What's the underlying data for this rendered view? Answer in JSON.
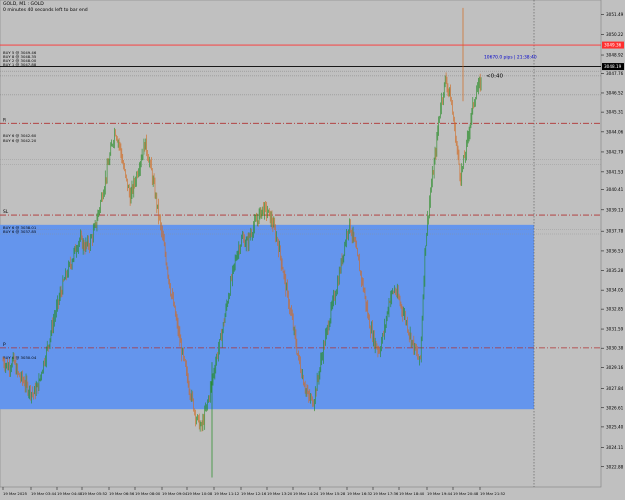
{
  "window": {
    "title": "GOLD, M1 : GOLD",
    "timer": "0 minutes 40 seconds left to bar end"
  },
  "colors": {
    "background": "#c0c0c0",
    "zone": "#6495ed",
    "bull": "#228b22",
    "bear": "#d2691e",
    "level_line": "#b03030",
    "price_line_red": "#ff3030",
    "price_line_black": "#000000",
    "label_blue": "#0000cc"
  },
  "chart_data": {
    "type": "candlestick",
    "symbol": "GOLD",
    "timeframe": "M1",
    "ylim": [
      3021.6,
      3052.4
    ],
    "y_ticks": [
      "3051.49",
      "3050.22",
      "3048.92",
      "3047.76",
      "3046.52",
      "3045.31",
      "3044.06",
      "3042.79",
      "3041.53",
      "3040.41",
      "3039.13",
      "3037.78",
      "3036.53",
      "3035.28",
      "3034.05",
      "3032.85",
      "3031.59",
      "3030.38",
      "3029.16",
      "3027.84",
      "3026.61",
      "3025.40",
      "3024.11",
      "3022.88"
    ],
    "x_ticks": [
      "19 Mar 2025",
      "19 Mar 03:44",
      "19 Mar 04:48",
      "19 Mar 05:52",
      "19 Mar 06:56",
      "19 Mar 08:00",
      "19 Mar 09:04",
      "19 Mar 10:08",
      "19 Mar 11:12",
      "19 Mar 12:16",
      "19 Mar 13:20",
      "19 Mar 14:24",
      "19 Mar 15:28",
      "19 Mar 16:32",
      "19 Mar 17:36",
      "19 Mar 18:40",
      "19 Mar 19:44",
      "19 Mar 20:48",
      "19 Mar 21:52"
    ],
    "ohlc_path": [
      3029.6,
      3029.2,
      3029.6,
      3028.7,
      3028.3,
      3027.8,
      3027.5,
      3028.1,
      3029.5,
      3030.8,
      3032.2,
      3033.5,
      3034.6,
      3035.5,
      3036.4,
      3037.3,
      3036.8,
      3037.0,
      3037.9,
      3039.3,
      3040.9,
      3042.5,
      3044.2,
      3043.1,
      3041.3,
      3039.9,
      3041.0,
      3042.3,
      3043.4,
      3041.8,
      3040.0,
      3038.0,
      3036.1,
      3034.0,
      3032.2,
      3030.5,
      3028.8,
      3027.4,
      3026.0,
      3025.3,
      3026.6,
      3028.2,
      3029.8,
      3031.3,
      3033.1,
      3034.9,
      3036.4,
      3037.3,
      3037.0,
      3037.9,
      3038.5,
      3039.2,
      3039.0,
      3038.3,
      3037.1,
      3035.4,
      3033.6,
      3031.8,
      3029.9,
      3028.4,
      3027.3,
      3027.0,
      3028.6,
      3030.4,
      3032.0,
      3033.4,
      3034.9,
      3036.6,
      3038.3,
      3037.2,
      3035.6,
      3033.9,
      3032.0,
      3030.8,
      3030.2,
      3031.6,
      3033.5,
      3034.1,
      3033.3,
      3032.4,
      3031.2,
      3030.3,
      3029.4,
      3036.7,
      3040.2,
      3042.6,
      3045.7,
      3047.4,
      3046.3,
      3043.6,
      3041.2,
      3042.9,
      3045.0,
      3046.6,
      3047.2
    ],
    "current_price": "3048.19",
    "levels": [
      {
        "id": "R",
        "label": "R",
        "price": 3044.6
      },
      {
        "id": "SL",
        "label": "SL",
        "price": 3038.8
      },
      {
        "id": "P",
        "label": "P",
        "price": 3030.4
      }
    ],
    "price_lines": [
      {
        "price": 3049.55,
        "color": "#ff3030",
        "axis_label": "3049.36"
      },
      {
        "price": 3048.19,
        "color": "#000000",
        "axis_label": "3048.19"
      }
    ],
    "zone": {
      "top": 3038.18,
      "bottom": 3026.52
    },
    "order_labels": [
      "BUY 5 @ 3049.46",
      "BUY 8 @ 3048.35",
      "BUY 2 @ 3048.00",
      "BUY 1 @ 3047.88",
      "BUY 6 @ 3042.60",
      "BUY 6 @ 3042.20",
      "BUY 6 @ 3038.01",
      "BUY 6 @ 3037.85",
      "BUY 6 @ 3030.04"
    ],
    "pip_label": "10670.0 pips | 21:38:40",
    "countdown_label": "<0:40"
  }
}
